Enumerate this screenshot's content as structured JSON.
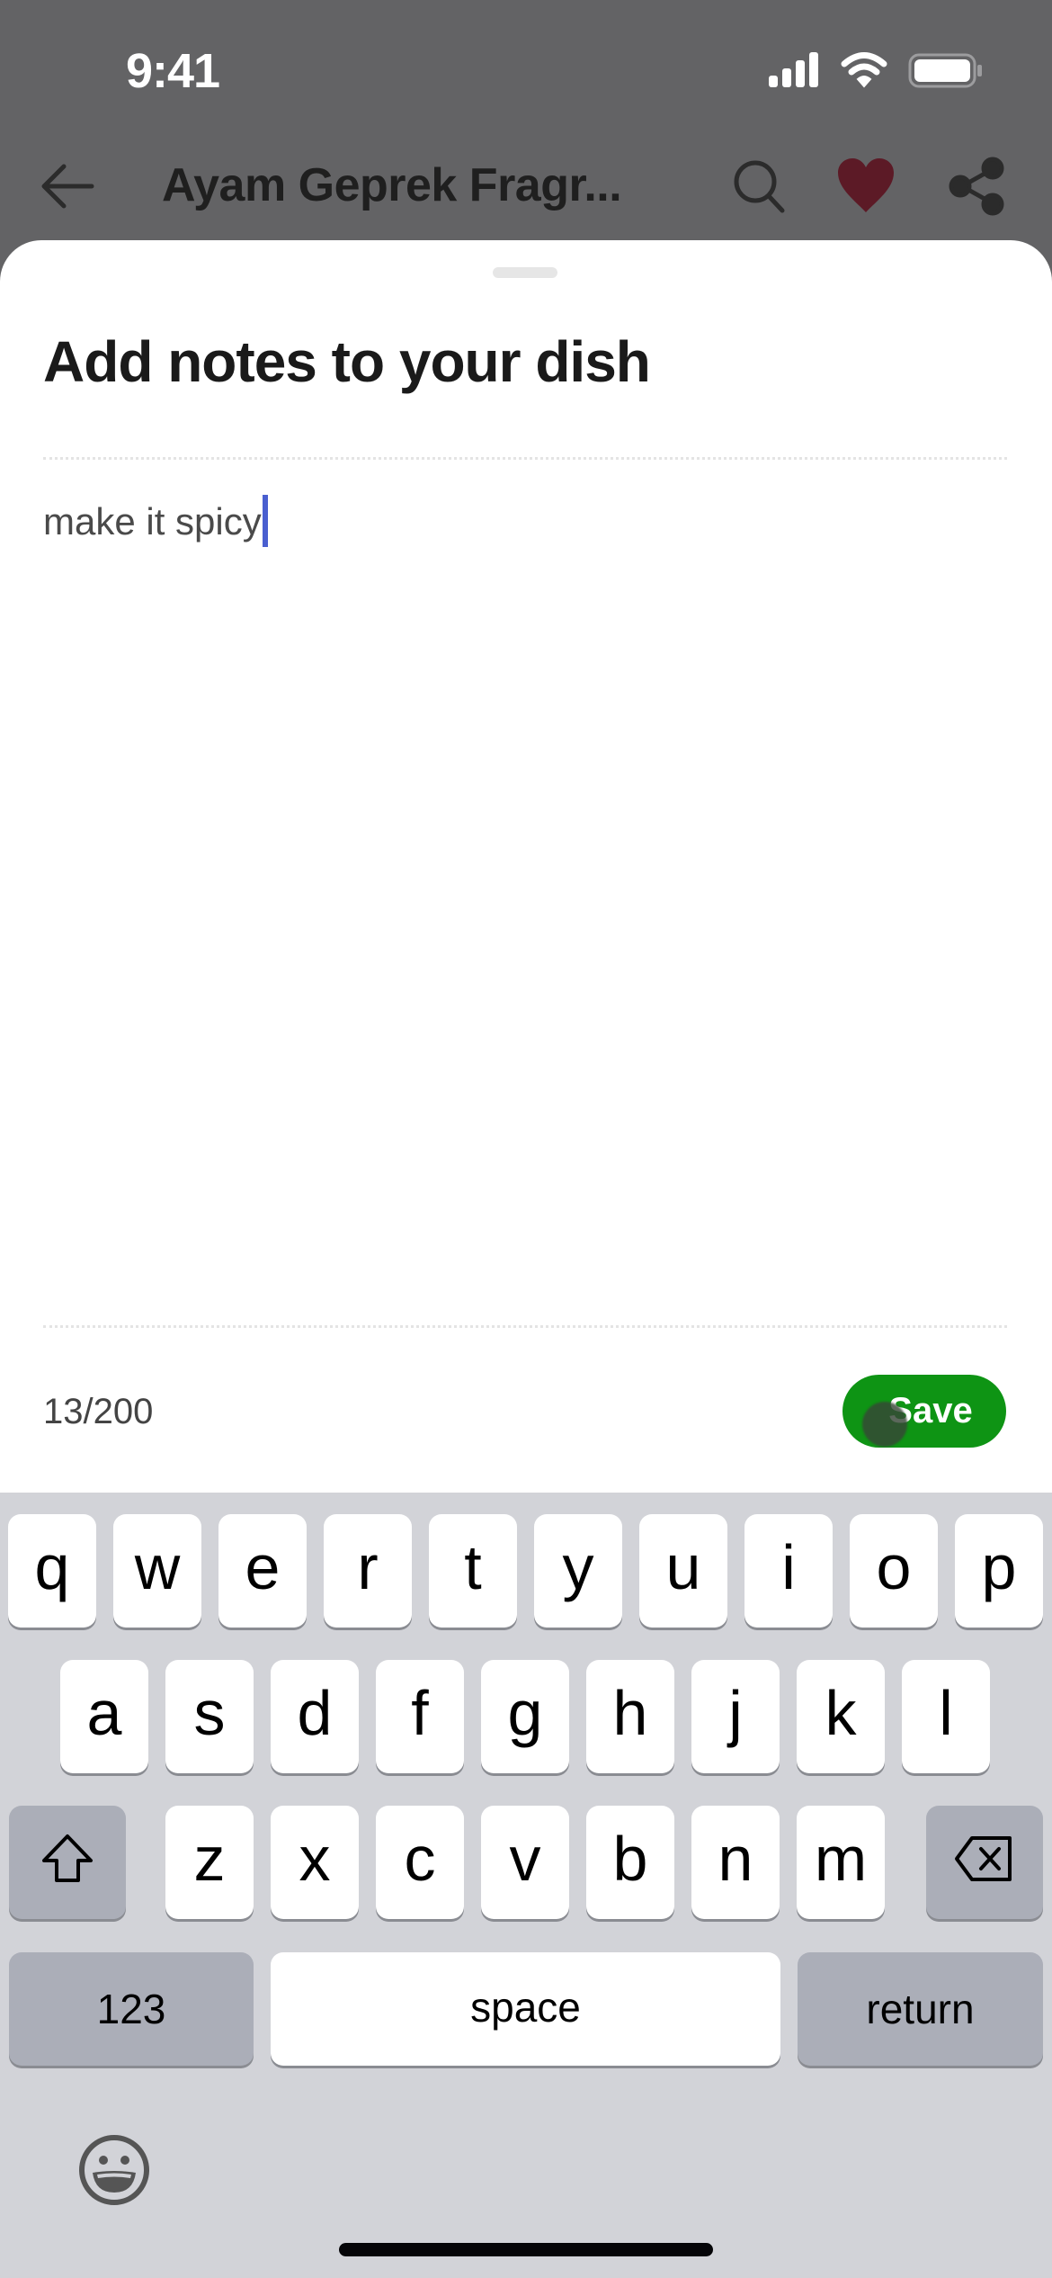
{
  "status_bar": {
    "time": "9:41",
    "icons": [
      "cellular-signal-icon",
      "wifi-icon",
      "battery-icon"
    ]
  },
  "nav_bar": {
    "back_icon": "arrow-left-icon",
    "title": "Ayam Geprek Fragr...",
    "actions": [
      {
        "name": "search",
        "icon": "search-icon"
      },
      {
        "name": "favorite",
        "icon": "heart-icon",
        "active": true,
        "color": "#5c1a26"
      },
      {
        "name": "share",
        "icon": "share-icon"
      }
    ]
  },
  "sheet": {
    "title": "Add notes to your dish",
    "note": {
      "value": "make it spicy",
      "char_count": 13,
      "max_chars": 200,
      "counter_label": "13/200"
    },
    "save_label": "Save",
    "accent_color": "#0e9414",
    "caret_color": "#4a5fd0"
  },
  "keyboard": {
    "rows": [
      [
        "q",
        "w",
        "e",
        "r",
        "t",
        "y",
        "u",
        "i",
        "o",
        "p"
      ],
      [
        "a",
        "s",
        "d",
        "f",
        "g",
        "h",
        "j",
        "k",
        "l"
      ],
      [
        "z",
        "x",
        "c",
        "v",
        "b",
        "n",
        "m"
      ]
    ],
    "shift_icon": "shift-icon",
    "delete_icon": "backspace-icon",
    "numbers_label": "123",
    "space_label": "space",
    "return_label": "return",
    "emoji_icon": "emoji-icon"
  }
}
